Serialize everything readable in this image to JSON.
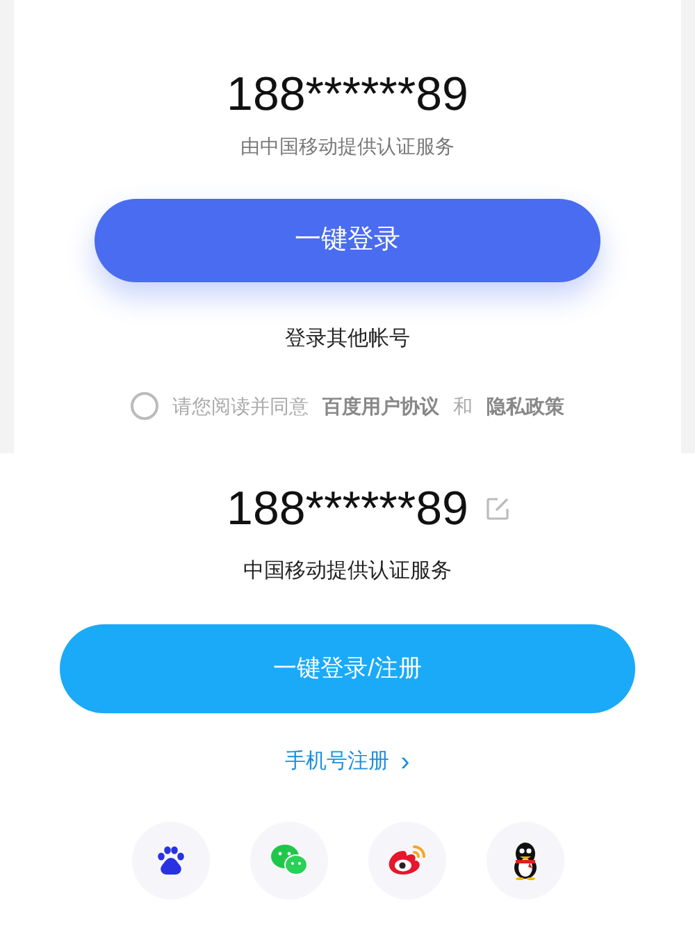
{
  "panels": [
    {
      "kind": "carrier",
      "phone": "188******89",
      "provider": "由中国移动提供认证服务",
      "login_button": "一键登录",
      "other_account": "登录其他帐号",
      "agreement": {
        "checked": false,
        "prefix": "请您阅读并同意",
        "terms": "百度用户协议",
        "joiner": "和",
        "privacy": "隐私政策"
      }
    },
    {
      "kind": "register",
      "phone": "188******89",
      "provider": "中国移动提供认证服务",
      "login_button": "一键登录/注册",
      "register_link": "手机号注册",
      "register_arrow": "›",
      "social": [
        {
          "kind": "paw"
        },
        {
          "kind": "chat"
        },
        {
          "kind": "weibo"
        },
        {
          "kind": "penguin"
        }
      ]
    }
  ]
}
